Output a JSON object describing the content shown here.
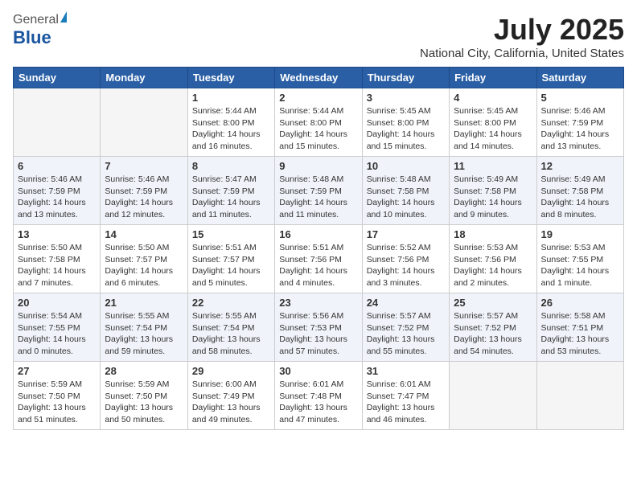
{
  "header": {
    "logo_general": "General",
    "logo_blue": "Blue",
    "month_title": "July 2025",
    "location": "National City, California, United States"
  },
  "weekdays": [
    "Sunday",
    "Monday",
    "Tuesday",
    "Wednesday",
    "Thursday",
    "Friday",
    "Saturday"
  ],
  "weeks": [
    [
      {
        "day": "",
        "info": ""
      },
      {
        "day": "",
        "info": ""
      },
      {
        "day": "1",
        "info": "Sunrise: 5:44 AM\nSunset: 8:00 PM\nDaylight: 14 hours and 16 minutes."
      },
      {
        "day": "2",
        "info": "Sunrise: 5:44 AM\nSunset: 8:00 PM\nDaylight: 14 hours and 15 minutes."
      },
      {
        "day": "3",
        "info": "Sunrise: 5:45 AM\nSunset: 8:00 PM\nDaylight: 14 hours and 15 minutes."
      },
      {
        "day": "4",
        "info": "Sunrise: 5:45 AM\nSunset: 8:00 PM\nDaylight: 14 hours and 14 minutes."
      },
      {
        "day": "5",
        "info": "Sunrise: 5:46 AM\nSunset: 7:59 PM\nDaylight: 14 hours and 13 minutes."
      }
    ],
    [
      {
        "day": "6",
        "info": "Sunrise: 5:46 AM\nSunset: 7:59 PM\nDaylight: 14 hours and 13 minutes."
      },
      {
        "day": "7",
        "info": "Sunrise: 5:46 AM\nSunset: 7:59 PM\nDaylight: 14 hours and 12 minutes."
      },
      {
        "day": "8",
        "info": "Sunrise: 5:47 AM\nSunset: 7:59 PM\nDaylight: 14 hours and 11 minutes."
      },
      {
        "day": "9",
        "info": "Sunrise: 5:48 AM\nSunset: 7:59 PM\nDaylight: 14 hours and 11 minutes."
      },
      {
        "day": "10",
        "info": "Sunrise: 5:48 AM\nSunset: 7:58 PM\nDaylight: 14 hours and 10 minutes."
      },
      {
        "day": "11",
        "info": "Sunrise: 5:49 AM\nSunset: 7:58 PM\nDaylight: 14 hours and 9 minutes."
      },
      {
        "day": "12",
        "info": "Sunrise: 5:49 AM\nSunset: 7:58 PM\nDaylight: 14 hours and 8 minutes."
      }
    ],
    [
      {
        "day": "13",
        "info": "Sunrise: 5:50 AM\nSunset: 7:58 PM\nDaylight: 14 hours and 7 minutes."
      },
      {
        "day": "14",
        "info": "Sunrise: 5:50 AM\nSunset: 7:57 PM\nDaylight: 14 hours and 6 minutes."
      },
      {
        "day": "15",
        "info": "Sunrise: 5:51 AM\nSunset: 7:57 PM\nDaylight: 14 hours and 5 minutes."
      },
      {
        "day": "16",
        "info": "Sunrise: 5:51 AM\nSunset: 7:56 PM\nDaylight: 14 hours and 4 minutes."
      },
      {
        "day": "17",
        "info": "Sunrise: 5:52 AM\nSunset: 7:56 PM\nDaylight: 14 hours and 3 minutes."
      },
      {
        "day": "18",
        "info": "Sunrise: 5:53 AM\nSunset: 7:56 PM\nDaylight: 14 hours and 2 minutes."
      },
      {
        "day": "19",
        "info": "Sunrise: 5:53 AM\nSunset: 7:55 PM\nDaylight: 14 hours and 1 minute."
      }
    ],
    [
      {
        "day": "20",
        "info": "Sunrise: 5:54 AM\nSunset: 7:55 PM\nDaylight: 14 hours and 0 minutes."
      },
      {
        "day": "21",
        "info": "Sunrise: 5:55 AM\nSunset: 7:54 PM\nDaylight: 13 hours and 59 minutes."
      },
      {
        "day": "22",
        "info": "Sunrise: 5:55 AM\nSunset: 7:54 PM\nDaylight: 13 hours and 58 minutes."
      },
      {
        "day": "23",
        "info": "Sunrise: 5:56 AM\nSunset: 7:53 PM\nDaylight: 13 hours and 57 minutes."
      },
      {
        "day": "24",
        "info": "Sunrise: 5:57 AM\nSunset: 7:52 PM\nDaylight: 13 hours and 55 minutes."
      },
      {
        "day": "25",
        "info": "Sunrise: 5:57 AM\nSunset: 7:52 PM\nDaylight: 13 hours and 54 minutes."
      },
      {
        "day": "26",
        "info": "Sunrise: 5:58 AM\nSunset: 7:51 PM\nDaylight: 13 hours and 53 minutes."
      }
    ],
    [
      {
        "day": "27",
        "info": "Sunrise: 5:59 AM\nSunset: 7:50 PM\nDaylight: 13 hours and 51 minutes."
      },
      {
        "day": "28",
        "info": "Sunrise: 5:59 AM\nSunset: 7:50 PM\nDaylight: 13 hours and 50 minutes."
      },
      {
        "day": "29",
        "info": "Sunrise: 6:00 AM\nSunset: 7:49 PM\nDaylight: 13 hours and 49 minutes."
      },
      {
        "day": "30",
        "info": "Sunrise: 6:01 AM\nSunset: 7:48 PM\nDaylight: 13 hours and 47 minutes."
      },
      {
        "day": "31",
        "info": "Sunrise: 6:01 AM\nSunset: 7:47 PM\nDaylight: 13 hours and 46 minutes."
      },
      {
        "day": "",
        "info": ""
      },
      {
        "day": "",
        "info": ""
      }
    ]
  ]
}
